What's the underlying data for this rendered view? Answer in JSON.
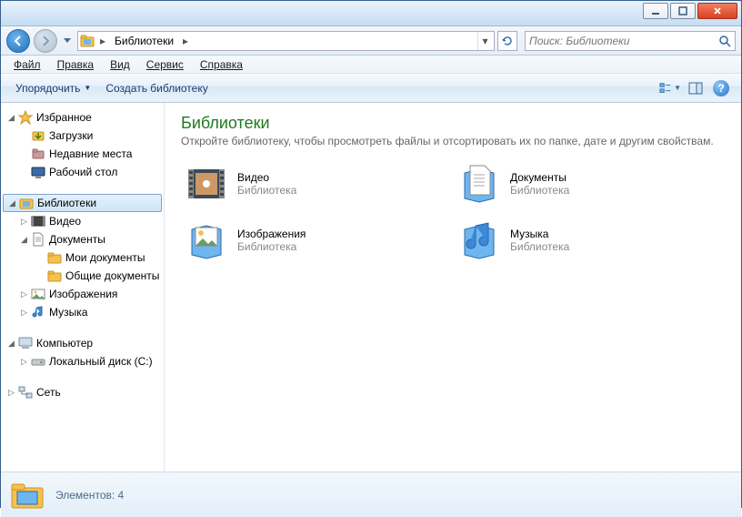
{
  "breadcrumb": {
    "root_arrow": "▸",
    "current": "Библиотеки",
    "arrow": "▸"
  },
  "search": {
    "placeholder": "Поиск: Библиотеки"
  },
  "menu": {
    "file": "Файл",
    "edit": "Правка",
    "view": "Вид",
    "tools": "Сервис",
    "help": "Справка"
  },
  "toolbar": {
    "organize": "Упорядочить",
    "new_library": "Создать библиотеку"
  },
  "sidebar": {
    "favorites": {
      "label": "Избранное",
      "downloads": "Загрузки",
      "recent": "Недавние места",
      "desktop": "Рабочий стол"
    },
    "libraries": {
      "label": "Библиотеки",
      "video": "Видео",
      "documents": "Документы",
      "my_docs": "Мои документы",
      "public_docs": "Общие документы",
      "images": "Изображения",
      "music": "Музыка"
    },
    "computer": {
      "label": "Компьютер",
      "local_disk": "Локальный диск (C:)"
    },
    "network": {
      "label": "Сеть"
    }
  },
  "content": {
    "title": "Библиотеки",
    "subtitle": "Откройте библиотеку, чтобы просмотреть файлы и отсортировать их по папке, дате и другим свойствам.",
    "sub_label": "Библиотека",
    "items": {
      "video": "Видео",
      "documents": "Документы",
      "images": "Изображения",
      "music": "Музыка"
    }
  },
  "status": {
    "text": "Элементов: 4"
  }
}
